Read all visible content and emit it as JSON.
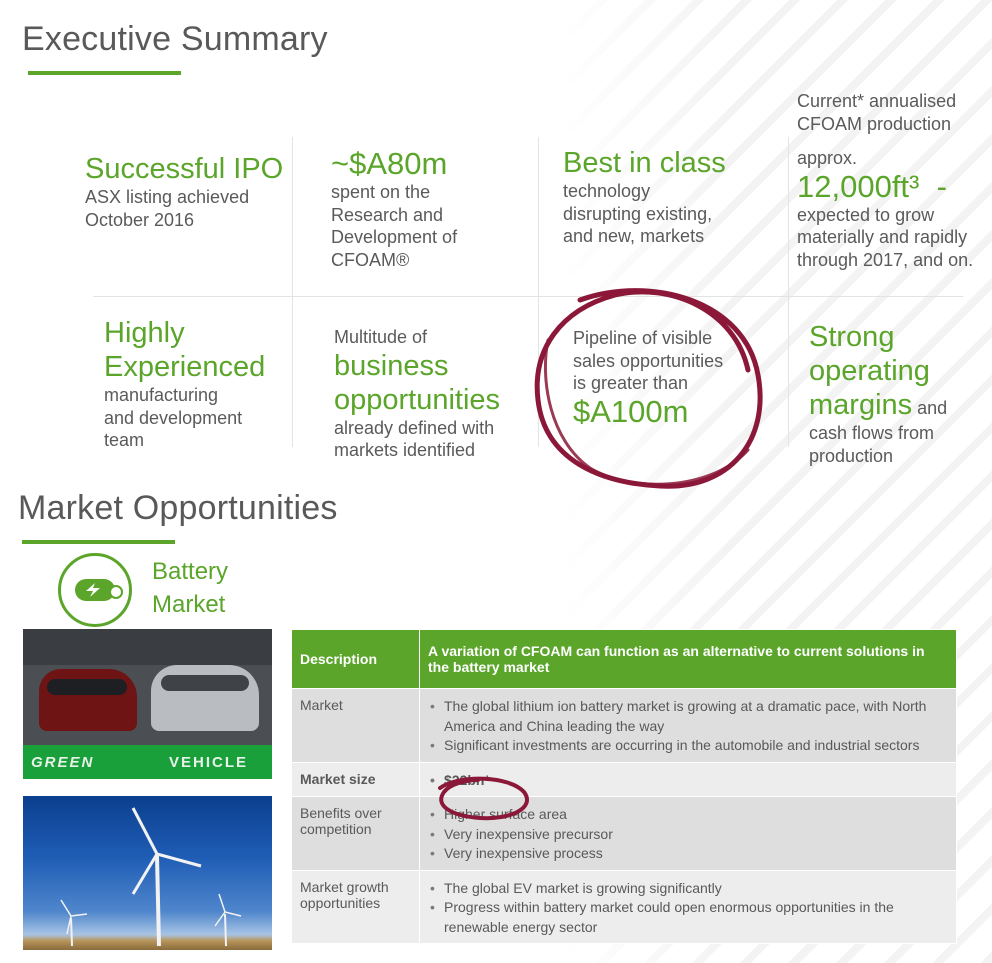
{
  "colors": {
    "accent": "#5aa52a",
    "annotation": "#8b1838",
    "text": "#5a5a5a"
  },
  "exec": {
    "title": "Executive Summary",
    "ipo": {
      "headline": "Successful IPO",
      "line1": "ASX listing achieved",
      "line2": "October 2016"
    },
    "rd": {
      "headline": "~$A80m",
      "l1": "spent on the",
      "l2": "Research and",
      "l3": "Development of",
      "l4": "CFOAM®"
    },
    "tech": {
      "headline": "Best in class",
      "l1": "technology",
      "l2": "disrupting existing,",
      "l3": "and new, markets"
    },
    "prod": {
      "l1": "Current* annualised",
      "l2": "CFOAM production",
      "approx": "approx.",
      "headline": "12,000ft³  -",
      "l3": "expected to grow",
      "l4": "materially and rapidly",
      "l5": "through 2017, and on."
    },
    "team": {
      "h1": "Highly",
      "h2": "Experienced",
      "l1": "manufacturing",
      "l2": "and development",
      "l3": "team"
    },
    "biz": {
      "pre": "Multitude of",
      "h1": "business",
      "h2": "opportunities",
      "l1": "already defined with",
      "l2": "markets identified"
    },
    "pipe": {
      "l1": "Pipeline of visible",
      "l2": "sales opportunities",
      "l3": "is greater than",
      "headline": "$A100m"
    },
    "margin": {
      "h1": "Strong",
      "h2": "operating",
      "h3": "margins",
      "tail": " and",
      "l1": "cash flows from",
      "l2": "production"
    }
  },
  "market": {
    "title": "Market Opportunities",
    "segment_l1": "Battery",
    "segment_l2": "Market",
    "icon": "battery-icon",
    "photo1_caption_left": "GREEN",
    "photo1_caption_right": "VEHICLE",
    "table": {
      "header_label": "Description",
      "header_value": "A variation of CFOAM can function as an alternative to current solutions in the battery market",
      "rows": [
        {
          "label": "Market",
          "items": [
            "The global lithium ion battery market is growing at a dramatic pace, with North America and China leading the way",
            "Significant investments are occurring in the automobile and industrial sectors"
          ]
        },
        {
          "label": "Market size",
          "items": [
            "$22bn*"
          ]
        },
        {
          "label": "Benefits over competition",
          "items": [
            "Higher surface area",
            "Very inexpensive precursor",
            "Very inexpensive process"
          ]
        },
        {
          "label": "Market growth opportunities",
          "items": [
            "The global EV market is growing significantly",
            "Progress within battery market could open enormous opportunities in the renewable energy sector"
          ]
        }
      ]
    }
  }
}
